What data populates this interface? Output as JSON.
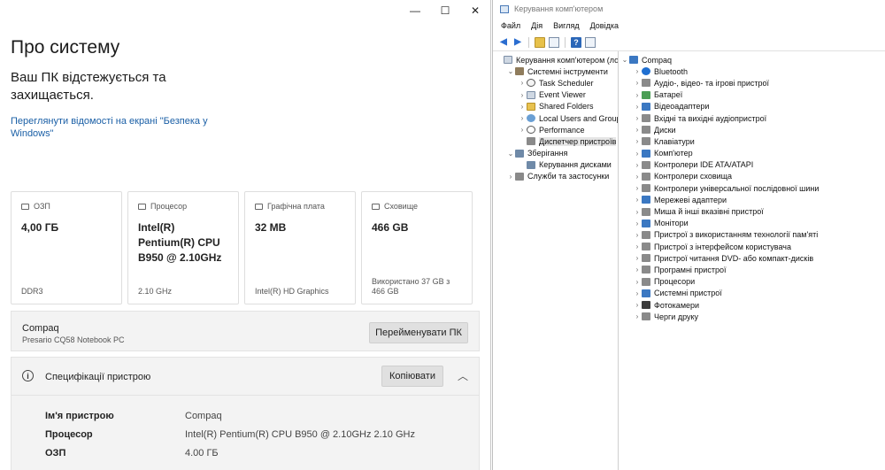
{
  "about": {
    "window_controls": [
      "—",
      "☐",
      "✕"
    ],
    "title": "Про систему",
    "protect_text": "Ваш ПК відстежується та захищається.",
    "security_link": "Переглянути відомості на екрані \"Безпека у Windows\"",
    "cards": [
      {
        "label": "ОЗП",
        "value": "4,00 ГБ",
        "footer": "DDR3"
      },
      {
        "label": "Процесор",
        "value": "Intel(R) Pentium(R) CPU B950 @ 2.10GHz",
        "footer": "2.10 GHz"
      },
      {
        "label": "Графічна плата",
        "value": "32 MB",
        "footer": "Intel(R) HD Graphics"
      },
      {
        "label": "Сховище",
        "value": "466 GB",
        "footer": "Використано 37 GB з 466 GB"
      }
    ],
    "device": {
      "name": "Compaq",
      "model": "Presario CQ58 Notebook PC",
      "rename_button": "Перейменувати ПК"
    },
    "specs": {
      "title": "Специфікації пристрою",
      "copy_button": "Копіювати",
      "rows": [
        {
          "key": "Ім'я пристрою",
          "value": "Compaq"
        },
        {
          "key": "Процесор",
          "value": "Intel(R) Pentium(R) CPU B950 @ 2.10GHz   2.10 GHz"
        },
        {
          "key": "ОЗП",
          "value": "4.00 ГБ"
        }
      ]
    }
  },
  "mgmt": {
    "title": "Керування комп'ютером",
    "menu": [
      "Файл",
      "Дія",
      "Вигляд",
      "Довідка"
    ],
    "toolbar_icons": [
      "back-arrow",
      "forward-arrow",
      "up-folder",
      "show-hide-tree",
      "help",
      "properties"
    ],
    "tree": [
      {
        "label": "Керування комп'ютером (лок",
        "level": 0,
        "twisty": "",
        "icon": "light"
      },
      {
        "label": "Системні інструменти",
        "level": 1,
        "twisty": "⌄",
        "icon": "tool"
      },
      {
        "label": "Task Scheduler",
        "level": 2,
        "twisty": "›",
        "icon": "clock"
      },
      {
        "label": "Event Viewer",
        "level": 2,
        "twisty": "›",
        "icon": "light"
      },
      {
        "label": "Shared Folders",
        "level": 2,
        "twisty": "›",
        "icon": "folder"
      },
      {
        "label": "Local Users and Groups",
        "level": 2,
        "twisty": "›",
        "icon": "user"
      },
      {
        "label": "Performance",
        "level": 2,
        "twisty": "›",
        "icon": "noentry"
      },
      {
        "label": "Диспетчер пристроїв",
        "level": 2,
        "twisty": "",
        "icon": "gray",
        "selected": true
      },
      {
        "label": "Зберігання",
        "level": 1,
        "twisty": "⌄",
        "icon": "storage"
      },
      {
        "label": "Керування дисками",
        "level": 2,
        "twisty": "",
        "icon": "storage"
      },
      {
        "label": "Служби та застосунки",
        "level": 1,
        "twisty": "›",
        "icon": "gray"
      }
    ],
    "devices_root": "Compaq",
    "devices": [
      {
        "label": "Bluetooth",
        "icon": "bt"
      },
      {
        "label": "Аудіо-, відео- та ігрові пристрої",
        "icon": "gray"
      },
      {
        "label": "Батареї",
        "icon": "green"
      },
      {
        "label": "Відеоадаптери",
        "icon": "blue"
      },
      {
        "label": "Вхідні та вихідні аудіопристрої",
        "icon": "gray"
      },
      {
        "label": "Диски",
        "icon": "gray"
      },
      {
        "label": "Клавіатури",
        "icon": "gray"
      },
      {
        "label": "Комп'ютер",
        "icon": "blue"
      },
      {
        "label": "Контролери IDE ATA/ATAPI",
        "icon": "gray"
      },
      {
        "label": "Контролери сховища",
        "icon": "gray"
      },
      {
        "label": "Контролери універсальної послідовної шини",
        "icon": "gray"
      },
      {
        "label": "Мережеві адаптери",
        "icon": "blue"
      },
      {
        "label": "Миша й інші вказівні пристрої",
        "icon": "gray"
      },
      {
        "label": "Монітори",
        "icon": "blue"
      },
      {
        "label": "Пристрої з використанням технології пам'яті",
        "icon": "gray"
      },
      {
        "label": "Пристрої з інтерфейсом користувача",
        "icon": "gray"
      },
      {
        "label": "Пристрої читання DVD- або компакт-дисків",
        "icon": "gray"
      },
      {
        "label": "Програмні пристрої",
        "icon": "gray"
      },
      {
        "label": "Процесори",
        "icon": "gray"
      },
      {
        "label": "Системні пристрої",
        "icon": "blue"
      },
      {
        "label": "Фотокамери",
        "icon": "dark"
      },
      {
        "label": "Черги друку",
        "icon": "gray"
      }
    ]
  }
}
